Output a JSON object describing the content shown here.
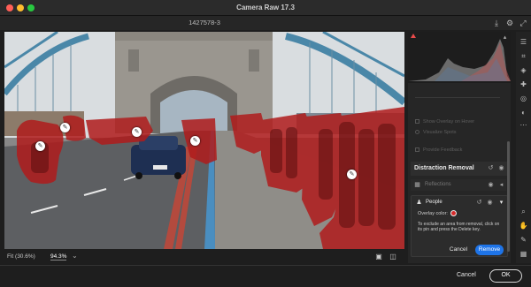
{
  "app_title": "Camera Raw 17.3",
  "file_name": "1427578-3",
  "toolbar": {
    "icons": [
      "save-icon",
      "settings-icon",
      "fullscreen-icon"
    ]
  },
  "zoom": {
    "fit_label": "Fit (30.6%)",
    "percent": "94.3%"
  },
  "panel": {
    "dim_options": [
      "Show Overlay on Hover",
      "Visualize Spots"
    ],
    "provide_feedback": "Provide Feedback",
    "section_title": "Distraction Removal",
    "reflections_label": "Reflections",
    "people": {
      "label": "People",
      "overlay_label": "Overlay color:",
      "overlay_color": "#d42a2a",
      "help_text": "To exclude an area from removal, click on its pin and press the Delete key.",
      "cancel_label": "Cancel",
      "remove_label": "Remove"
    }
  },
  "tools": [
    "sliders-icon",
    "crop-icon",
    "eraser-icon",
    "heal-icon",
    "redeye-icon",
    "presets-icon",
    "more-icon",
    "zoom-icon",
    "hand-icon",
    "sampler-icon",
    "grid-icon"
  ],
  "footer": {
    "cancel_label": "Cancel",
    "ok_label": "OK"
  },
  "colors": {
    "accent": "#1e74e8",
    "mask": "#b01c1c"
  }
}
